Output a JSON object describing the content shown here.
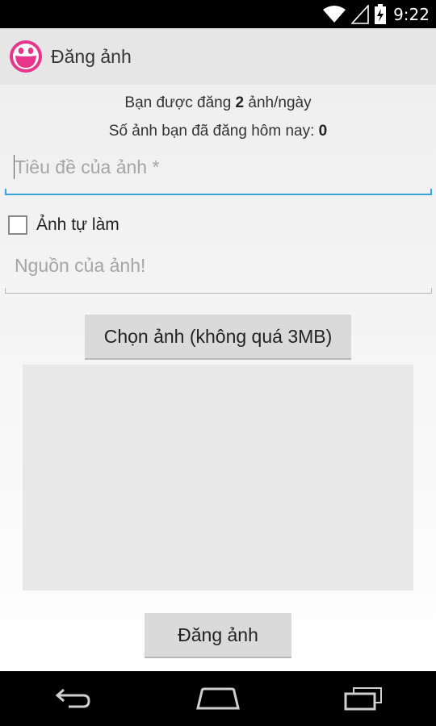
{
  "status_bar": {
    "time": "9:22",
    "icons": [
      "wifi-icon",
      "signal-icon",
      "battery-charging-icon"
    ]
  },
  "action_bar": {
    "title": "Đăng ảnh",
    "logo_icon": "smiley-logo-icon"
  },
  "info": {
    "line1_prefix": "Bạn được đăng ",
    "line1_value": "2",
    "line1_suffix": " ảnh/ngày",
    "line2_prefix": "Số ảnh bạn đã đăng hôm nay: ",
    "line2_value": "0"
  },
  "form": {
    "title_field": {
      "placeholder": "Tiêu đề của ảnh *",
      "value": ""
    },
    "self_made_checkbox": {
      "label": "Ảnh tự làm",
      "checked": false
    },
    "source_field": {
      "placeholder": "Nguồn của ảnh!",
      "value": ""
    },
    "choose_button_label": "Chọn ảnh (không quá 3MB)",
    "post_button_label": "Đăng ảnh"
  },
  "nav_bar": {
    "icons": [
      "back-icon",
      "home-icon",
      "recent-apps-icon"
    ]
  },
  "colors": {
    "accent": "#33a3d8",
    "logo": "#e8358a",
    "background": "#f3f3f3"
  }
}
